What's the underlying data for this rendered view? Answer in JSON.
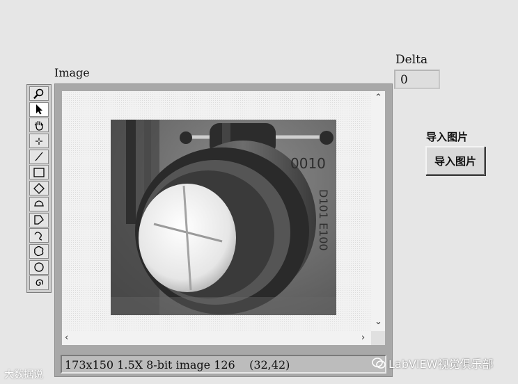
{
  "image_control": {
    "label": "Image",
    "status_text": "173x150 1.5X 8-bit image 126    (32,42)",
    "tools": [
      {
        "name": "zoom-icon"
      },
      {
        "name": "arrow-pointer-icon"
      },
      {
        "name": "pan-hand-icon"
      },
      {
        "name": "point-crosshair-icon"
      },
      {
        "name": "line-tool-icon"
      },
      {
        "name": "rectangle-tool-icon"
      },
      {
        "name": "rotated-rectangle-icon"
      },
      {
        "name": "annulus-arc-icon"
      },
      {
        "name": "polygon-tool-icon"
      },
      {
        "name": "freehand-line-icon"
      },
      {
        "name": "freehand-region-icon"
      },
      {
        "name": "oval-tool-icon"
      },
      {
        "name": "spiral-icon"
      }
    ],
    "scroll_icons": [
      "chevron-up-icon",
      "chevron-down-icon",
      "chevron-left-icon",
      "chevron-right-icon"
    ]
  },
  "delta": {
    "label": "Delta",
    "value": "0"
  },
  "import_control": {
    "label": "导入图片",
    "button_label": "导入图片"
  },
  "watermarks": {
    "left": "大数据说",
    "right": "LabVIEW视觉俱乐部"
  },
  "colors": {
    "background": "#e6e6e6",
    "frame": "#a8a8a8",
    "status_bar": "#bcbcbc"
  }
}
